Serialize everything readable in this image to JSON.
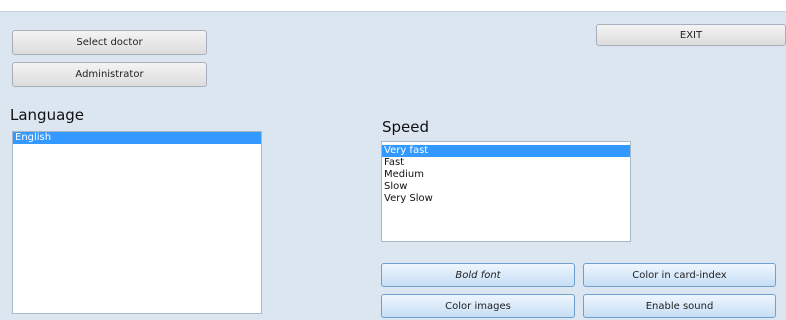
{
  "buttons": {
    "select_doctor": "Select doctor",
    "administrator": "Administrator",
    "exit": "EXIT",
    "bold_font": "Bold font",
    "color_in_card_index": "Color in card-index",
    "color_images": "Color images",
    "enable_sound": "Enable sound"
  },
  "language": {
    "label": "Language",
    "items": [
      {
        "label": "English",
        "selected": true
      }
    ]
  },
  "speed": {
    "label": "Speed",
    "items": [
      {
        "label": "Very fast",
        "selected": true
      },
      {
        "label": "Fast",
        "selected": false
      },
      {
        "label": "Medium",
        "selected": false
      },
      {
        "label": "Slow",
        "selected": false
      },
      {
        "label": "Very Slow",
        "selected": false
      }
    ]
  },
  "colors": {
    "background": "#dbe6f1",
    "selection": "#3399ff"
  }
}
